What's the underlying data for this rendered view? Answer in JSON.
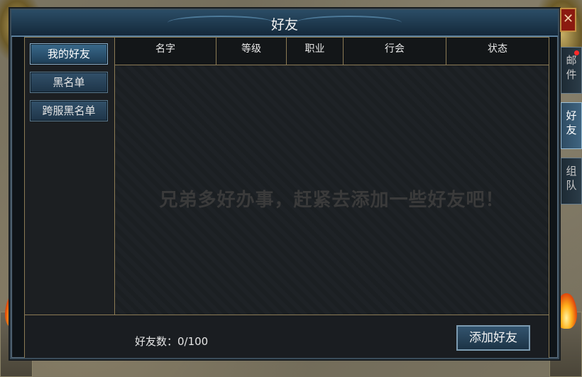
{
  "window": {
    "title": "好友",
    "close_label": "✕"
  },
  "nav": [
    {
      "label": "我的好友",
      "active": true
    },
    {
      "label": "黑名单",
      "active": false
    },
    {
      "label": "跨服黑名单",
      "active": false
    }
  ],
  "table": {
    "columns": [
      "名字",
      "等级",
      "职业",
      "行会",
      "状态"
    ],
    "rows": [],
    "empty_message": "兄弟多好办事，赶紧去添加一些好友吧！"
  },
  "footer": {
    "count_text": "好友数：0/100",
    "add_button_label": "添加好友"
  },
  "side_tabs": [
    {
      "chars": [
        "邮",
        "件"
      ],
      "active": false,
      "notification": true
    },
    {
      "chars": [
        "好",
        "友"
      ],
      "active": true,
      "notification": false
    },
    {
      "chars": [
        "组",
        "队"
      ],
      "active": false,
      "notification": false
    }
  ],
  "colors": {
    "frame_gold": "#8c7b55",
    "title_blue": "#2b4d66",
    "close_red": "#8b1a10"
  },
  "icons": {
    "close": "close-icon",
    "notification": "red-dot-icon"
  }
}
